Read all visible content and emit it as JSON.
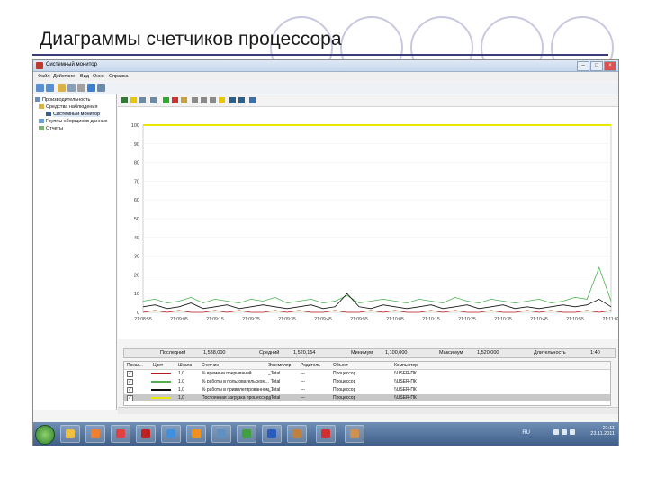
{
  "slide": {
    "title": "Диаграммы счетчиков процессора"
  },
  "window": {
    "title": "Системный монитор",
    "controls": {
      "minimize": "–",
      "maximize": "□",
      "close": "×"
    }
  },
  "menu": [
    "Файл",
    "Действие",
    "Вид",
    "Окно",
    "Справка"
  ],
  "tree": {
    "items": [
      {
        "label": "Производительность",
        "level": 0
      },
      {
        "label": "Средства наблюдения",
        "level": 1
      },
      {
        "label": "Системный монитор",
        "level": 2,
        "selected": true
      },
      {
        "label": "Группы сборщиков данных",
        "level": 1
      },
      {
        "label": "Отчеты",
        "level": 1
      }
    ]
  },
  "chart_data": {
    "type": "line",
    "y_ticks": [
      "100",
      "90",
      "80",
      "70",
      "60",
      "50",
      "40",
      "30",
      "20",
      "10",
      "0"
    ],
    "ylim": [
      0,
      100
    ],
    "x_ticks": [
      "21:08:55",
      "21:09:05",
      "21:09:15",
      "21:09:25",
      "21:09:35",
      "21:09:45",
      "21:09:55",
      "21:10:05",
      "21:10:15",
      "21:10:25",
      "21:10:35",
      "21:10:45",
      "21:10:55",
      "21:11:02"
    ],
    "series": [
      {
        "name": "% времени прерываний",
        "color": "#b71c1c",
        "values": [
          0,
          1,
          0,
          1,
          0,
          0,
          1,
          0,
          1,
          0,
          0,
          1,
          0,
          1,
          0,
          0,
          1,
          0,
          0,
          1,
          0,
          1,
          0,
          0,
          1,
          0,
          1,
          0,
          0,
          1,
          0,
          0,
          1,
          0,
          1,
          0,
          0,
          1,
          0,
          1
        ]
      },
      {
        "name": "% работы в пользовательском режиме",
        "color": "#4caf50",
        "values": [
          6,
          7,
          5,
          6,
          8,
          5,
          7,
          6,
          5,
          7,
          6,
          8,
          5,
          6,
          7,
          5,
          6,
          9,
          5,
          6,
          7,
          6,
          5,
          7,
          6,
          5,
          8,
          6,
          5,
          7,
          6,
          5,
          6,
          7,
          5,
          6,
          8,
          7,
          24,
          6
        ]
      },
      {
        "name": "% работы в привилегированном режиме",
        "color": "#111111",
        "values": [
          3,
          4,
          2,
          3,
          5,
          2,
          3,
          4,
          2,
          3,
          4,
          3,
          2,
          3,
          4,
          2,
          3,
          10,
          3,
          2,
          4,
          3,
          2,
          3,
          4,
          2,
          3,
          4,
          2,
          3,
          4,
          2,
          3,
          2,
          3,
          4,
          3,
          4,
          7,
          3
        ]
      },
      {
        "name": "Постоянная загрузка процессора",
        "color": "#e8e800",
        "values": [
          100,
          100,
          100,
          100,
          100,
          100,
          100,
          100,
          100,
          100,
          100,
          100,
          100,
          100,
          100,
          100,
          100,
          100,
          100,
          100,
          100,
          100,
          100,
          100,
          100,
          100,
          100,
          100,
          100,
          100,
          100,
          100,
          100,
          100,
          100,
          100,
          100,
          100,
          100,
          100
        ]
      }
    ]
  },
  "stats": {
    "last_label": "Последний",
    "last_value": "1,538,000",
    "avg_label": "Средний",
    "avg_value": "1,520,154",
    "min_label": "Минимум",
    "min_value": "1,100,000",
    "max_label": "Максимум",
    "max_value": "1,520,000",
    "duration_label": "Длительность",
    "duration_value": "1:40"
  },
  "counter_table": {
    "headers": [
      "Показ...",
      "Цвет",
      "Шкала",
      "Счетчик",
      "Экземпляр",
      "Родитель",
      "Объект",
      "Компьютер"
    ],
    "rows": [
      {
        "show": "✓",
        "color": "#b71c1c",
        "scale": "1,0",
        "counter": "% времени прерываний",
        "instance": "_Total",
        "parent": "---",
        "object": "Процессор",
        "computer": "\\\\USER-ПК"
      },
      {
        "show": "✓",
        "color": "#4caf50",
        "scale": "1,0",
        "counter": "% работы в пользовательском...",
        "instance": "_Total",
        "parent": "---",
        "object": "Процессор",
        "computer": "\\\\USER-ПК"
      },
      {
        "show": "✓",
        "color": "#111111",
        "scale": "1,0",
        "counter": "% работы в привилегированном...",
        "instance": "_Total",
        "parent": "---",
        "object": "Процессор",
        "computer": "\\\\USER-ПК"
      },
      {
        "show": "✓",
        "color": "#e8e800",
        "scale": "1,0",
        "counter": "Постоянная загрузка процессора",
        "instance": "_Total",
        "parent": "---",
        "object": "Процессор",
        "computer": "\\\\USER-ПК",
        "selected": true
      }
    ]
  },
  "taskbar": {
    "lang": "RU",
    "time": "21:11",
    "date": "23.11.2011",
    "apps": [
      {
        "name": "explorer",
        "color": "#f0c040"
      },
      {
        "name": "media-player",
        "color": "#f08030"
      },
      {
        "name": "chrome",
        "color": "#e04040"
      },
      {
        "name": "opera",
        "color": "#c02020"
      },
      {
        "name": "network",
        "color": "#4090e0"
      },
      {
        "name": "vlc",
        "color": "#f09020"
      },
      {
        "name": "monitor",
        "color": "#6090c0"
      },
      {
        "name": "utorrent",
        "color": "#40a040"
      },
      {
        "name": "word",
        "color": "#2a5cc0"
      },
      {
        "name": "notes",
        "color": "#c08040"
      },
      {
        "name": "perfmon",
        "color": "#d03030"
      },
      {
        "name": "tool",
        "color": "#d09050"
      }
    ]
  }
}
